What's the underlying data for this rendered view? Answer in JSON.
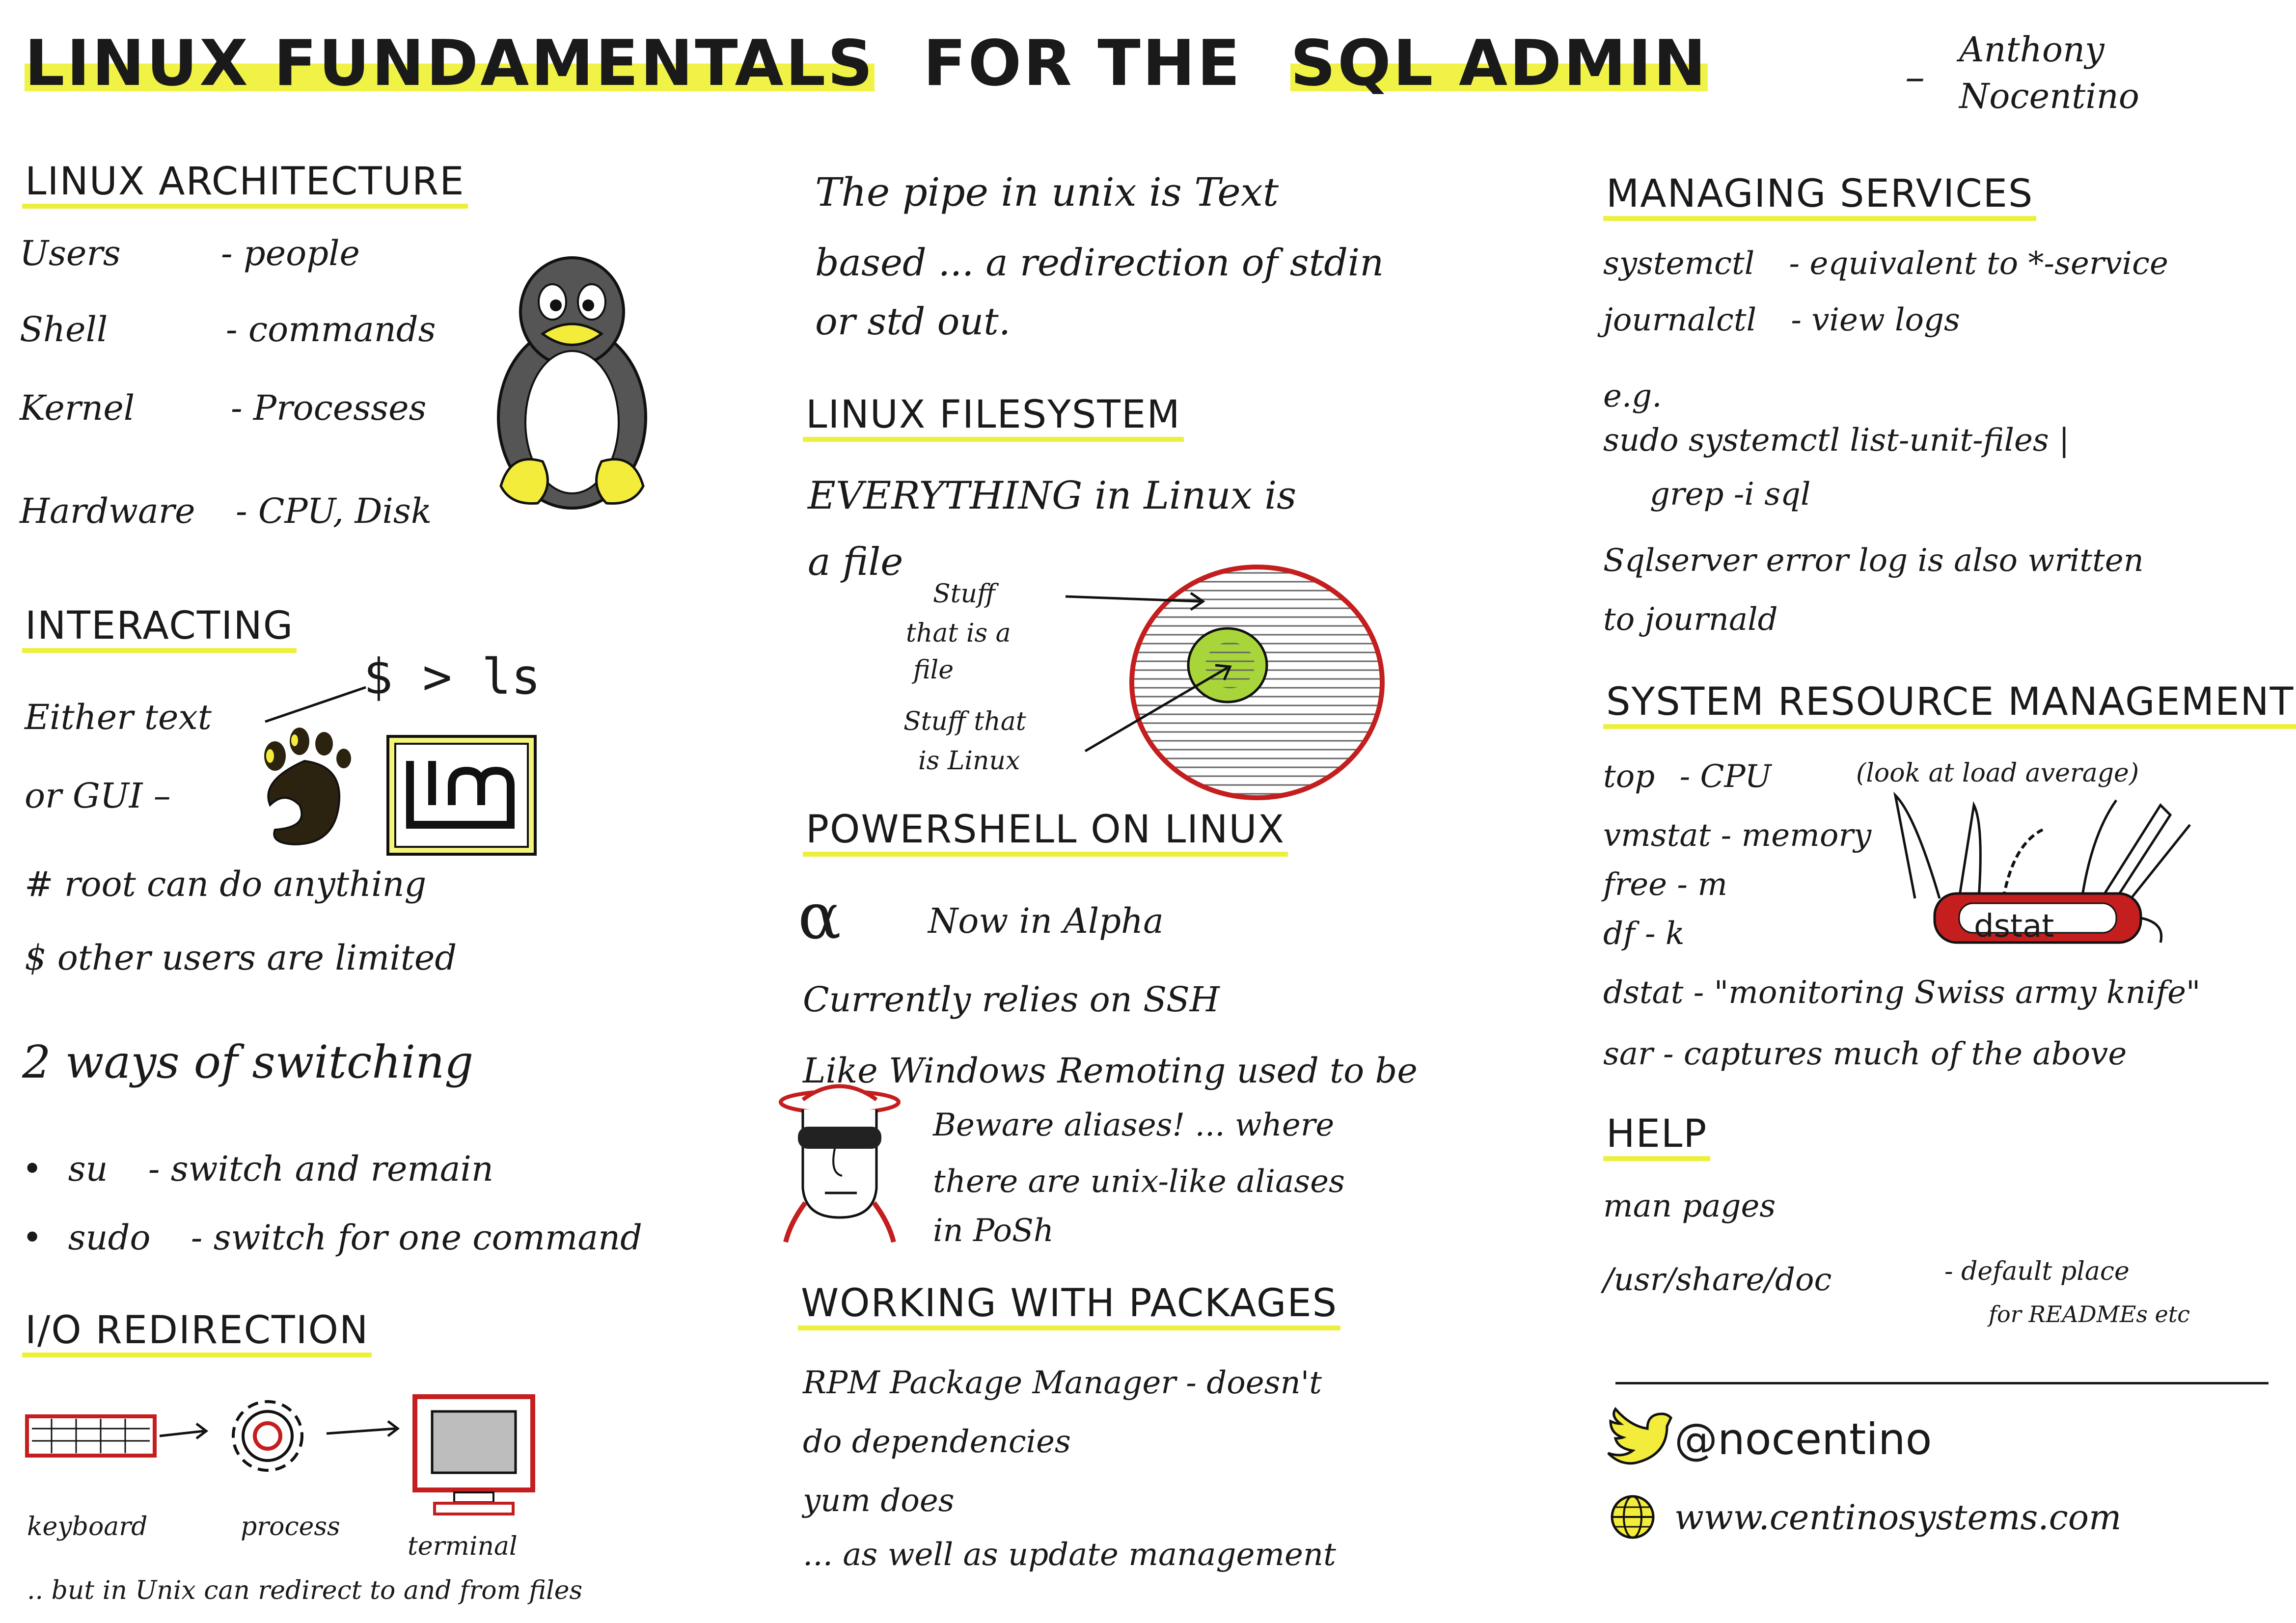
{
  "title": {
    "part1": "LINUX FUNDAMENTALS",
    "part2": "FOR THE",
    "part3": "SQL ADMIN",
    "dash": "–",
    "author_line1": "Anthony",
    "author_line2": "Nocentino"
  },
  "architecture": {
    "heading": "LINUX ARCHITECTURE",
    "rows": [
      {
        "term": "Users",
        "desc": "- people"
      },
      {
        "term": "Shell",
        "desc": "- commands"
      },
      {
        "term": "Kernel",
        "desc": "- Processes"
      },
      {
        "term": "Hardware",
        "desc": "- CPU, Disk"
      }
    ]
  },
  "interacting": {
    "heading": "INTERACTING",
    "either_text": "Either text",
    "prompt": "$ > ls",
    "or_gui": "or GUI –",
    "root_line": "# root can do anything",
    "user_line": "$ other users are limited",
    "ways": "2 ways of switching",
    "su_cmd": "su",
    "su_desc": "- switch and remain",
    "sudo_cmd": "sudo",
    "sudo_desc": "- switch for one command"
  },
  "io": {
    "heading": "I/O REDIRECTION",
    "keyboard": "keyboard",
    "process": "process",
    "terminal": "terminal",
    "footer": ".. but in Unix can redirect to and from files"
  },
  "pipe": {
    "line1": "The pipe in unix is Text",
    "line2": "based ... a redirection of stdin",
    "line3": "or std out."
  },
  "filesystem": {
    "heading": "LINUX FILESYSTEM",
    "line1": "EVERYTHING in Linux is",
    "line2": "a file",
    "label_file_1": "Stuff",
    "label_file_2": "that is a",
    "label_file_3": "file",
    "label_linux_1": "Stuff that",
    "label_linux_2": "is Linux"
  },
  "powershell": {
    "heading": "POWERSHELL ON LINUX",
    "alpha_symbol": "α",
    "alpha": "Now in Alpha",
    "ssh": "Currently relies on SSH",
    "remoting": "Like Windows Remoting used to be",
    "beware1": "Beware aliases! ... where",
    "beware2": "there are unix-like aliases",
    "beware3": "in PoSh"
  },
  "packages": {
    "heading": "WORKING WITH PACKAGES",
    "line1": "RPM Package Manager - doesn't",
    "line2": "do dependencies",
    "line3": "yum does",
    "line4": "... as well as update management"
  },
  "services": {
    "heading": "MANAGING SERVICES",
    "line1_cmd": "systemctl",
    "line1_desc": "- equivalent to *-service",
    "line2_cmd": "journalctl",
    "line2_desc": "- view logs",
    "eg": "e.g.",
    "example1": "sudo systemctl list-unit-files |",
    "example2": "grep -i sql",
    "note1": "Sqlserver error log is also written",
    "note2": "to journald"
  },
  "resources": {
    "heading": "SYSTEM RESOURCE MANAGEMENT",
    "top_cmd": "top",
    "top_desc": "- CPU",
    "top_note": "(look at load average)",
    "vmstat": "vmstat - memory",
    "free": "free - m",
    "df": "df - k",
    "dstat_label": "dstat",
    "dstat": "dstat - \"monitoring Swiss army knife\"",
    "sar": "sar - captures much of the above"
  },
  "help": {
    "heading": "HELP",
    "man": "man pages",
    "doc_path": "/usr/share/doc",
    "doc_desc1": "- default place",
    "doc_desc2": "for READMEs etc"
  },
  "contact": {
    "twitter": "@nocentino",
    "web": "www.centinosystems.com"
  },
  "colors": {
    "highlight": "#ecf03c",
    "red": "#c41e1e",
    "green": "#a8d63a",
    "ink": "#1a1a1a"
  }
}
